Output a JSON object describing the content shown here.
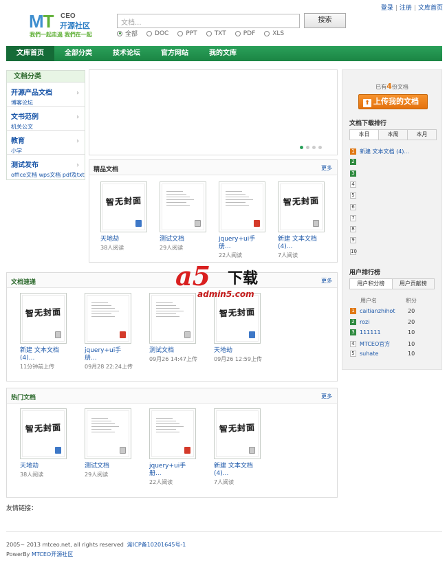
{
  "toplinks": {
    "login": "登录",
    "register": "注册",
    "home": "文库首页"
  },
  "logo": {
    "mt": "MT",
    "ceo": "CEO",
    "name": "开源社区",
    "slogan": "我們一起走過  我們在一起"
  },
  "search": {
    "placeholder": "文档...",
    "button": "搜索",
    "filters": [
      {
        "label": "全部",
        "selected": true
      },
      {
        "label": "DOC",
        "selected": false
      },
      {
        "label": "PPT",
        "selected": false
      },
      {
        "label": "TXT",
        "selected": false
      },
      {
        "label": "PDF",
        "selected": false
      },
      {
        "label": "XLS",
        "selected": false
      }
    ]
  },
  "nav": [
    "文库首页",
    "全部分类",
    "技术论坛",
    "官方网站",
    "我的文库"
  ],
  "sidebar": {
    "title": "文档分类",
    "items": [
      {
        "title": "开源产品文档",
        "sub": "博客论坛"
      },
      {
        "title": "文书范例",
        "sub": "机关公文"
      },
      {
        "title": "教育",
        "sub": "小学"
      },
      {
        "title": "测试发布",
        "sub": "office文档 wps文档 pdf及txt"
      }
    ]
  },
  "featured": {
    "title": "精品文档",
    "more": "更多",
    "docs": [
      {
        "name": "天地劫",
        "meta": "38人阅读",
        "type": "word",
        "thumb": "cover"
      },
      {
        "name": "测试文档",
        "meta": "29人阅读",
        "type": "txt",
        "thumb": "text"
      },
      {
        "name": "jquery+ui手册...",
        "meta": "22人阅读",
        "type": "pdf",
        "thumb": "text"
      },
      {
        "name": "新建 文本文档 (4)...",
        "meta": "7人阅读",
        "type": "txt",
        "thumb": "cover"
      }
    ]
  },
  "recent": {
    "title": "文档速递",
    "more": "更多",
    "docs": [
      {
        "name": "新建 文本文档 (4)...",
        "meta": "11分钟前上传",
        "type": "txt",
        "thumb": "cover"
      },
      {
        "name": "jquery+ui手册...",
        "meta": "09月28 22:24上传",
        "type": "pdf",
        "thumb": "text"
      },
      {
        "name": "测试文档",
        "meta": "09月26 14:47上传",
        "type": "txt",
        "thumb": "text"
      },
      {
        "name": "天地劫",
        "meta": "09月26 12:59上传",
        "type": "word",
        "thumb": "cover"
      }
    ]
  },
  "hot": {
    "title": "热门文档",
    "more": "更多",
    "docs": [
      {
        "name": "天地劫",
        "meta": "38人阅读",
        "type": "word",
        "thumb": "cover"
      },
      {
        "name": "测试文档",
        "meta": "29人阅读",
        "type": "txt",
        "thumb": "text"
      },
      {
        "name": "jquery+ui手册...",
        "meta": "22人阅读",
        "type": "pdf",
        "thumb": "text"
      },
      {
        "name": "新建 文本文档 (4)...",
        "meta": "7人阅读",
        "type": "txt",
        "thumb": "cover"
      }
    ]
  },
  "cover_text": "智无封面",
  "right": {
    "count_prefix": "已有",
    "count": "4",
    "count_suffix": "份文档",
    "upload": "上传我的文档",
    "rank_title": "文档下载排行",
    "rank_tabs": [
      "本日",
      "本周",
      "本月"
    ],
    "rank_items": [
      {
        "n": "1",
        "label": "新建 文本文档 (4)..."
      },
      {
        "n": "2",
        "label": ""
      },
      {
        "n": "3",
        "label": ""
      },
      {
        "n": "4",
        "label": ""
      },
      {
        "n": "5",
        "label": ""
      },
      {
        "n": "6",
        "label": ""
      },
      {
        "n": "7",
        "label": ""
      },
      {
        "n": "8",
        "label": ""
      },
      {
        "n": "9",
        "label": ""
      },
      {
        "n": "10",
        "label": ""
      }
    ],
    "user_title": "用户排行榜",
    "user_tabs": [
      "用户积分榜",
      "用户贡献榜"
    ],
    "user_head": {
      "name": "用户名",
      "score": "积分"
    },
    "users": [
      {
        "n": "1",
        "name": "caitianzhihot",
        "score": "20"
      },
      {
        "n": "2",
        "name": "rozi",
        "score": "20"
      },
      {
        "n": "3",
        "name": "111111",
        "score": "10"
      },
      {
        "n": "4",
        "name": "MTCEO官方",
        "score": "10"
      },
      {
        "n": "5",
        "name": "suhate",
        "score": "10"
      }
    ]
  },
  "watermark": {
    "a5": "a5",
    "dl": "下载",
    "url": "admin5.com"
  },
  "footer": {
    "friends": "友情链接：",
    "copyright": "2005~ 2013 mtceo.net, all rights reserved",
    "icp": "渝ICP备10201645号-1",
    "powered_prefix": "PowerBy",
    "powered_name": "MTCEO开源社区"
  }
}
